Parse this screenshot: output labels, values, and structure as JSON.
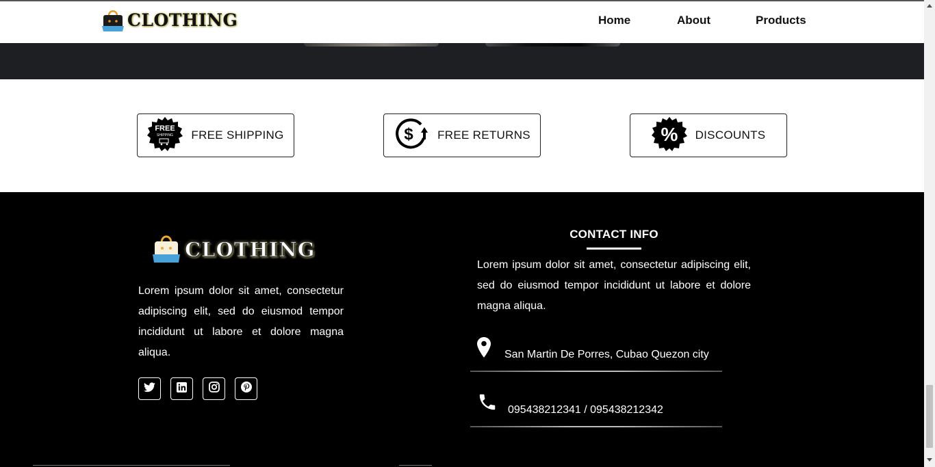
{
  "header": {
    "logo_text": "CLOTHING",
    "nav": [
      {
        "label": "Home"
      },
      {
        "label": "About"
      },
      {
        "label": "Products"
      }
    ]
  },
  "features": [
    {
      "label": "FREE SHIPPING",
      "icon": "free-shipping-badge-icon",
      "badge_text": "FREE",
      "badge_subtext": "SHIPPING"
    },
    {
      "label": "FREE RETURNS",
      "icon": "dollar-return-icon"
    },
    {
      "label": "DISCOUNTS",
      "icon": "percent-badge-icon"
    }
  ],
  "footer": {
    "logo_text": "CLOTHING",
    "description": "Lorem ipsum dolor sit amet, consectetur adipiscing elit, sed do eiusmod tempor incididunt ut labore et dolore magna aliqua.",
    "socials": [
      {
        "icon": "twitter-icon"
      },
      {
        "icon": "linkedin-icon"
      },
      {
        "icon": "instagram-icon"
      },
      {
        "icon": "pinterest-icon"
      }
    ],
    "contact": {
      "title": "CONTACT INFO",
      "description": "Lorem ipsum dolor sit amet, consectetur adipiscing elit, sed do eiusmod tempor incididunt ut labore et dolore magna aliqua.",
      "address": "San Martin De Porres, Cubao Quezon city",
      "phone": "095438212341 / 095438212342"
    }
  },
  "colors": {
    "header_bg": "#ffffff",
    "dark_strip": "#1e1f22",
    "footer_bg": "#000000",
    "text_dark": "#111111",
    "text_light": "#ffffff"
  }
}
